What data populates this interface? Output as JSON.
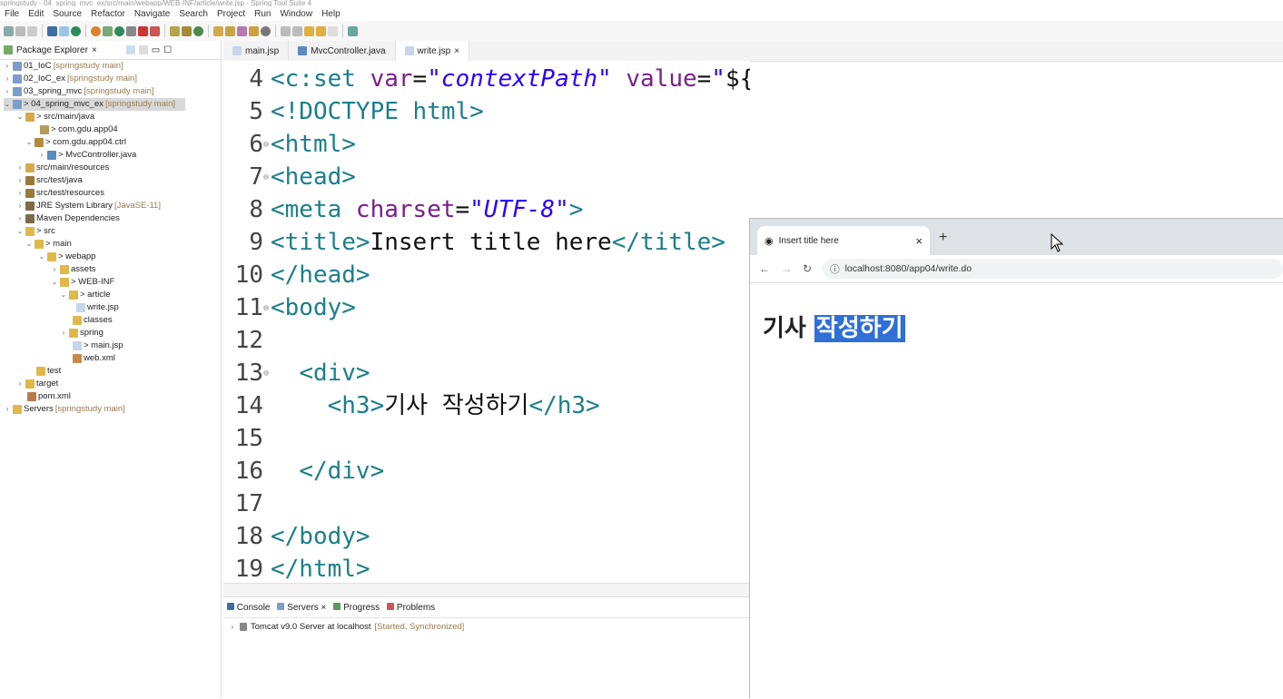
{
  "window": {
    "title": "springstudy - 04_spring_mvc_ex/src/main/webapp/WEB-INF/article/write.jsp - Spring Tool Suite 4"
  },
  "menu": [
    "File",
    "Edit",
    "Source",
    "Refactor",
    "Navigate",
    "Search",
    "Project",
    "Run",
    "Window",
    "Help"
  ],
  "explorer": {
    "title": "Package Explorer",
    "items": [
      {
        "label": "01_IoC",
        "dec": "[springstudy main]"
      },
      {
        "label": "02_IoC_ex",
        "dec": "[springstudy main]"
      },
      {
        "label": "03_spring_mvc",
        "dec": "[springstudy main]"
      },
      {
        "label": "> 04_spring_mvc_ex",
        "dec": "[springstudy main]"
      },
      {
        "label": "> src/main/java",
        "dec": ""
      },
      {
        "label": "> com.gdu.app04",
        "dec": ""
      },
      {
        "label": "> com.gdu.app04.ctrl",
        "dec": ""
      },
      {
        "label": "> MvcController.java",
        "dec": ""
      },
      {
        "label": "src/main/resources",
        "dec": ""
      },
      {
        "label": "src/test/java",
        "dec": ""
      },
      {
        "label": "src/test/resources",
        "dec": ""
      },
      {
        "label": "JRE System Library",
        "dec": "[JavaSE-11]"
      },
      {
        "label": "Maven Dependencies",
        "dec": ""
      },
      {
        "label": "> src",
        "dec": ""
      },
      {
        "label": "> main",
        "dec": ""
      },
      {
        "label": "> webapp",
        "dec": ""
      },
      {
        "label": "assets",
        "dec": ""
      },
      {
        "label": "> WEB-INF",
        "dec": ""
      },
      {
        "label": "> article",
        "dec": ""
      },
      {
        "label": "write.jsp",
        "dec": ""
      },
      {
        "label": "classes",
        "dec": ""
      },
      {
        "label": "spring",
        "dec": ""
      },
      {
        "label": "> main.jsp",
        "dec": ""
      },
      {
        "label": "web.xml",
        "dec": ""
      },
      {
        "label": "test",
        "dec": ""
      },
      {
        "label": "target",
        "dec": ""
      },
      {
        "label": "pom.xml",
        "dec": ""
      },
      {
        "label": "Servers",
        "dec": "[springstudy main]"
      }
    ]
  },
  "editor_tabs": [
    "main.jsp",
    "MvcController.java",
    "write.jsp"
  ],
  "code": {
    "l4": {
      "num": "4",
      "a": "<c:set ",
      "b": "var",
      "c": "=",
      "d": "\"contextPath\"",
      "e": " value",
      "f": "=",
      "g": "\"",
      "h": "${pageContext.request.contextPath}",
      "i": "\"",
      "j": "/>"
    },
    "l5": {
      "num": "5",
      "a": "<!DOCTYPE html>"
    },
    "l6": {
      "num": "6",
      "a": "<html>"
    },
    "l7": {
      "num": "7",
      "a": "<head>"
    },
    "l8": {
      "num": "8",
      "a": "<meta ",
      "b": "charset",
      "c": "=",
      "d": "\"UTF-8\"",
      "e": ">"
    },
    "l9": {
      "num": "9",
      "a": "<title>",
      "b": "Insert title here",
      "c": "</title>"
    },
    "l10": {
      "num": "10",
      "a": "</head>"
    },
    "l11": {
      "num": "11",
      "a": "<body>"
    },
    "l12": {
      "num": "12"
    },
    "l13": {
      "num": "13",
      "a": "<div>"
    },
    "l14": {
      "num": "14",
      "a": "<h3>",
      "b": "기사 작성하기",
      "c": "</h3>"
    },
    "l15": {
      "num": "15"
    },
    "l16": {
      "num": "16",
      "a": "</div>"
    },
    "l17": {
      "num": "17"
    },
    "l18": {
      "num": "18",
      "a": "</body>"
    },
    "l19": {
      "num": "19",
      "a": "</html>"
    }
  },
  "console": {
    "tabs": [
      "Console",
      "Servers",
      "Progress",
      "Problems"
    ],
    "server": "Tomcat v9.0 Server at localhost",
    "server_status": "[Started, Synchronized]"
  },
  "browser": {
    "tab_title": "Insert title here",
    "close": "×",
    "new_tab": "+",
    "url": "localhost:8080/app04/write.do",
    "heading_plain": "기사 ",
    "heading_selected": "작성하기"
  },
  "colors": {
    "accent": "#2f6fd6",
    "tag": "#1b7f8a",
    "attr": "#7a1f8a",
    "string": "#2a00ff"
  }
}
